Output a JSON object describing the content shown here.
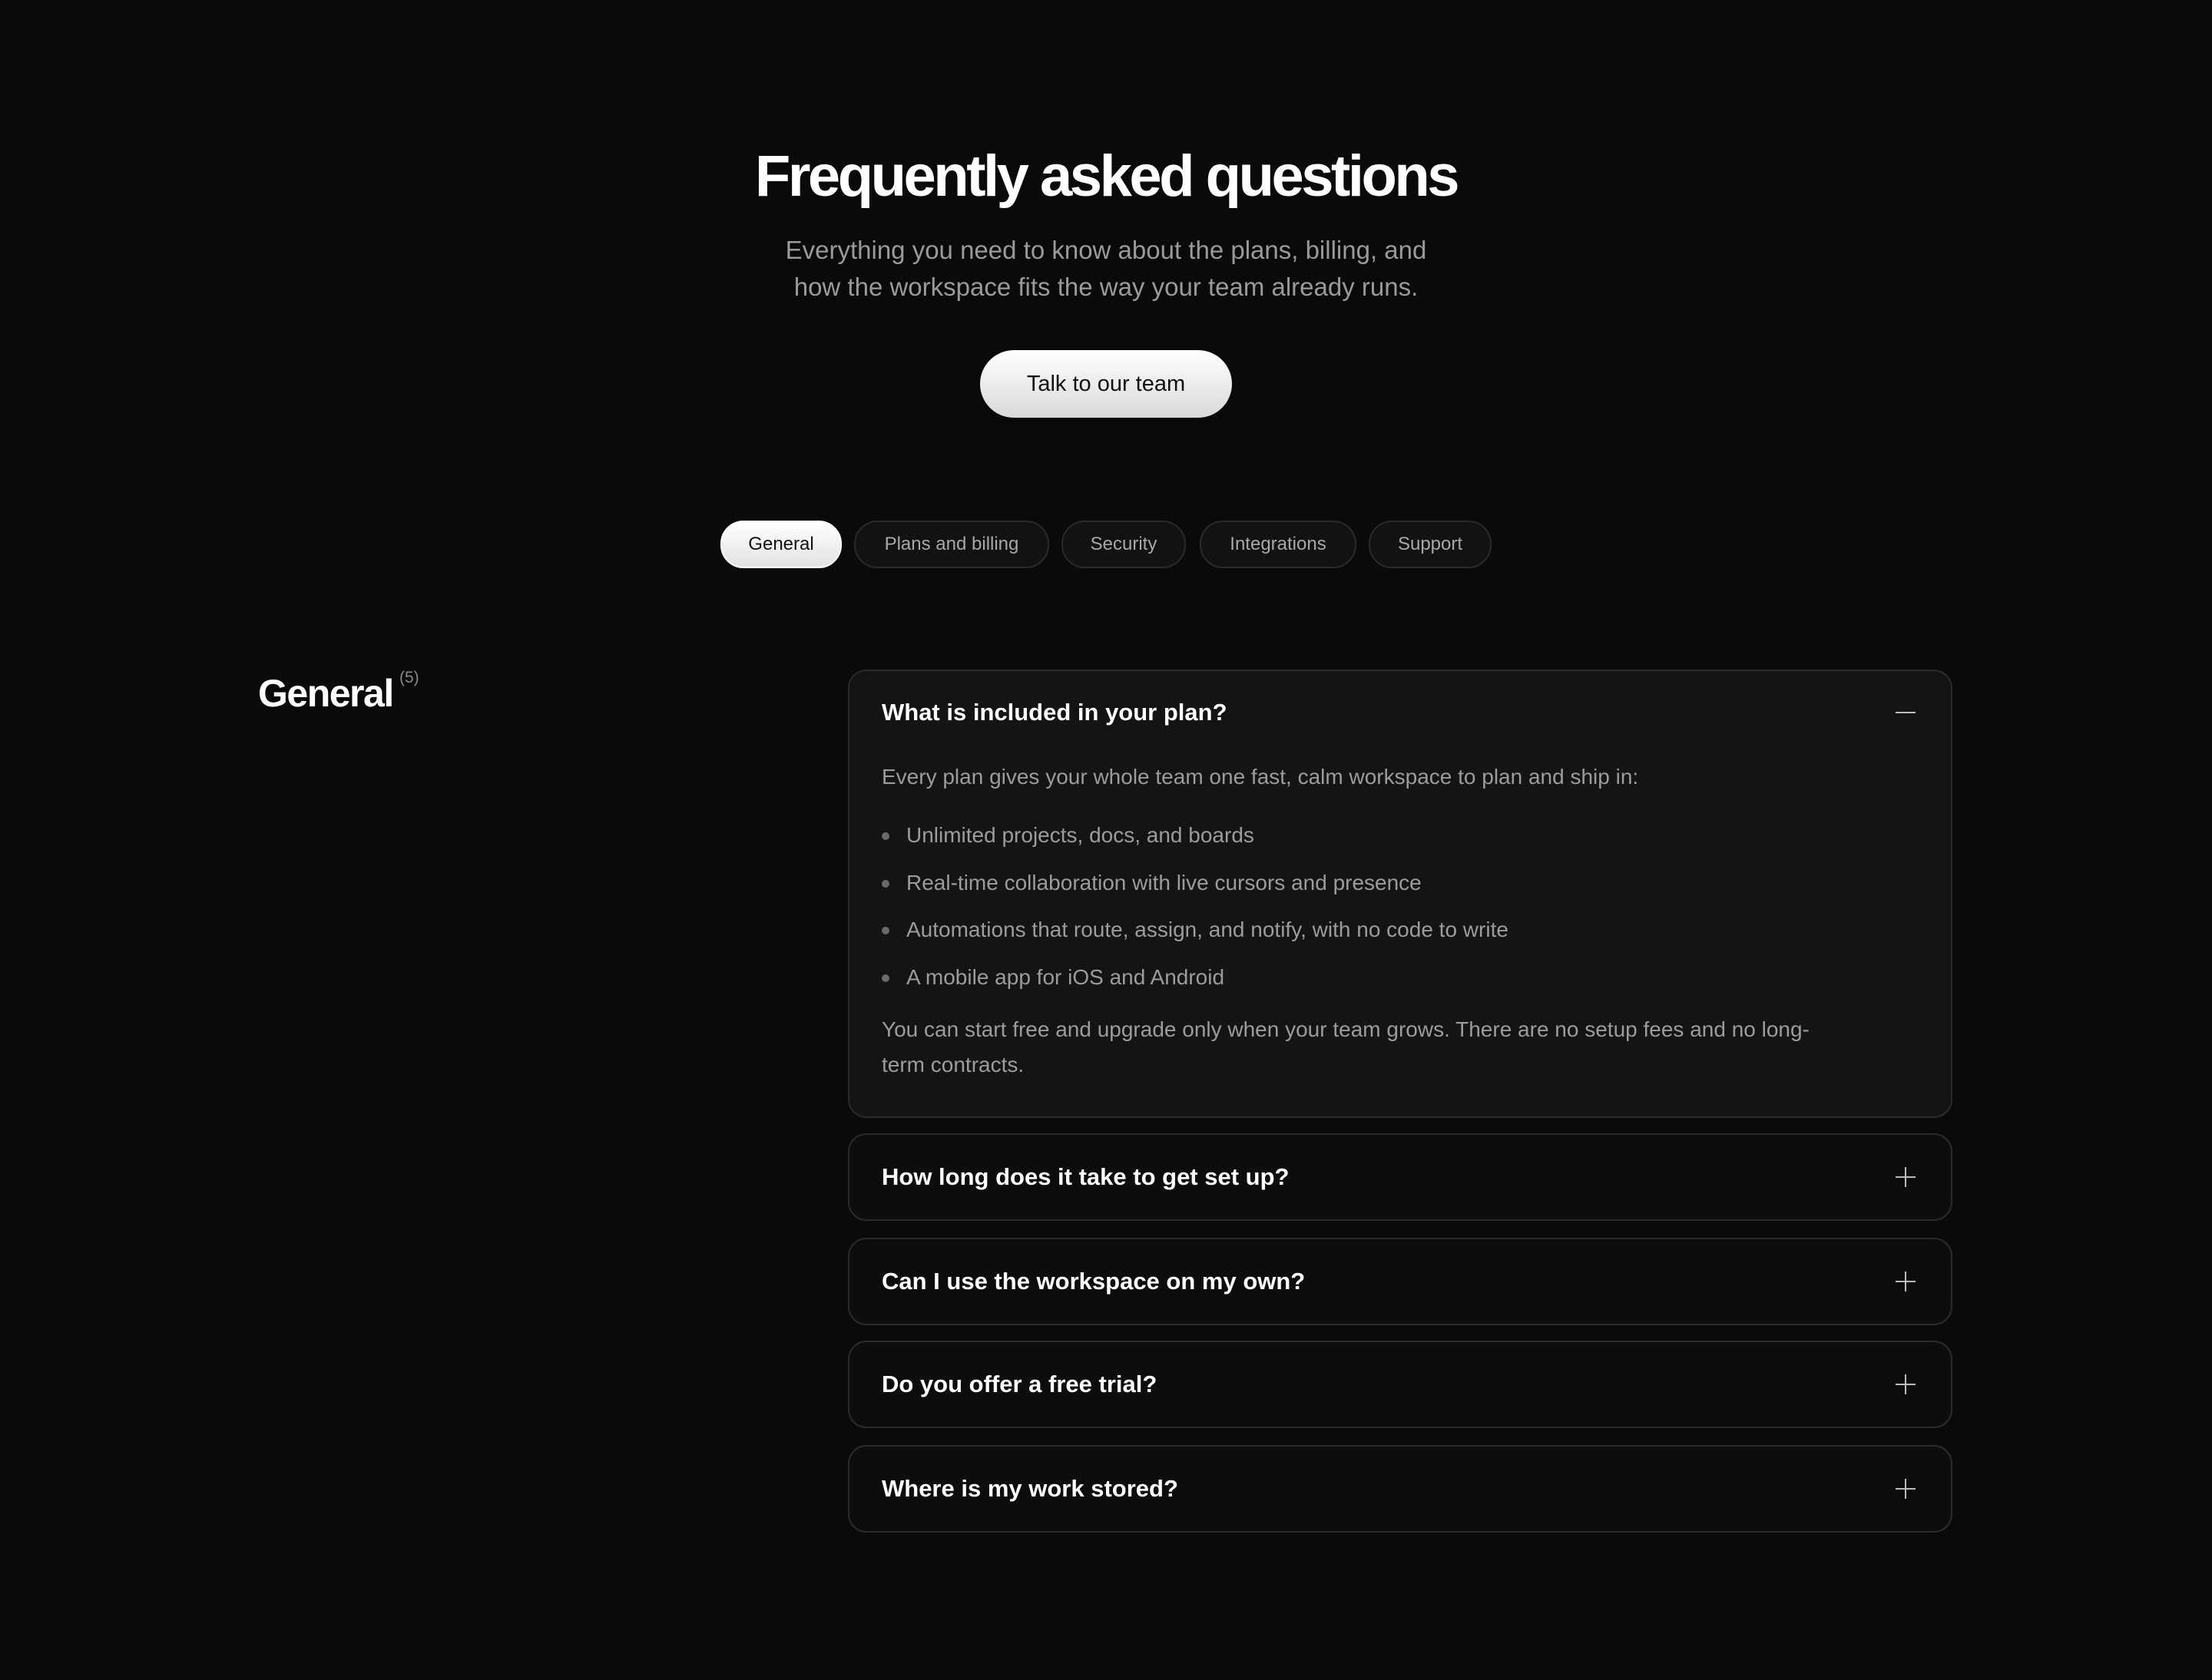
{
  "hero": {
    "title": "Frequently asked questions",
    "subtitle_line1": "Everything you need to know about the plans, billing, and",
    "subtitle_line2": "how the workspace fits the way your team already runs.",
    "cta_label": "Talk to our team"
  },
  "tabs": [
    {
      "label": "General",
      "active": true
    },
    {
      "label": "Plans and billing",
      "active": false
    },
    {
      "label": "Security",
      "active": false
    },
    {
      "label": "Integrations",
      "active": false
    },
    {
      "label": "Support",
      "active": false
    }
  ],
  "section": {
    "title": "General",
    "count": "(5)"
  },
  "faqs": [
    {
      "question": "What is included in your plan?",
      "expanded": true,
      "toggle_icon": "minus-icon",
      "answer_intro": "Every plan gives your whole team one fast, calm workspace to plan and ship in:",
      "answer_items": [
        "Unlimited projects, docs, and boards",
        "Real-time collaboration with live cursors and presence",
        "Automations that route, assign, and notify, with no code to write",
        "A mobile app for iOS and Android"
      ],
      "answer_outro_line1": "You can start free and upgrade only when your team grows. There are no setup fees and no long-",
      "answer_outro_line2": "term contracts."
    },
    {
      "question": "How long does it take to get set up?",
      "expanded": false,
      "toggle_icon": "plus-icon"
    },
    {
      "question": "Can I use the workspace on my own?",
      "expanded": false,
      "toggle_icon": "plus-icon"
    },
    {
      "question": "Do you offer a free trial?",
      "expanded": false,
      "toggle_icon": "plus-icon"
    },
    {
      "question": "Where is my work stored?",
      "expanded": false,
      "toggle_icon": "plus-icon"
    }
  ],
  "colors": {
    "background": "#0a0a0a",
    "card_border": "#2a2a2a",
    "muted_text": "#9c9c9c"
  }
}
